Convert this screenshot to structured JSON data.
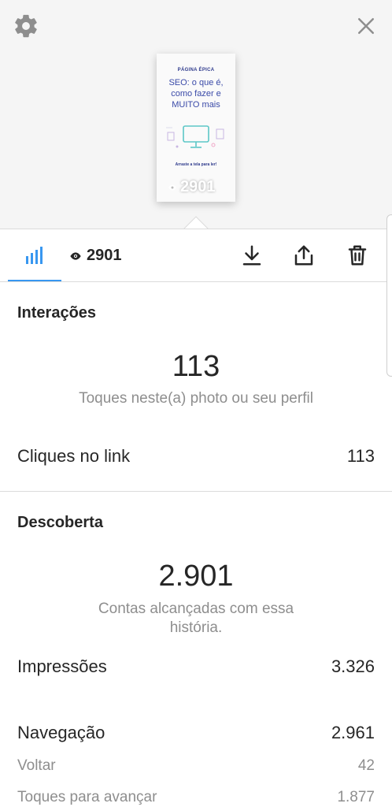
{
  "preview": {
    "thumb_kicker": "PÁGINA ÉPICA",
    "thumb_title": "SEO: o que é, como fazer e MUITO mais",
    "thumb_cta": "Arraste a tela para ler!",
    "thumb_views": "2901"
  },
  "tabbar": {
    "viewer_count": "2901"
  },
  "interactions": {
    "title": "Interações",
    "big_number": "113",
    "description": "Toques neste(a) photo ou seu perfil",
    "link_clicks_label": "Cliques no link",
    "link_clicks_value": "113"
  },
  "discovery": {
    "title": "Descoberta",
    "big_number": "2.901",
    "description": "Contas alcançadas com essa história.",
    "impressions_label": "Impressões",
    "impressions_value": "3.326",
    "navigation_label": "Navegação",
    "navigation_value": "2.961",
    "back_label": "Voltar",
    "back_value": "42",
    "forward_label": "Toques para avançar",
    "forward_value": "1.877"
  },
  "colors": {
    "accent": "#3897f0",
    "text": "#262626",
    "muted": "#8e8e8e",
    "divider": "#dbdbdb"
  }
}
